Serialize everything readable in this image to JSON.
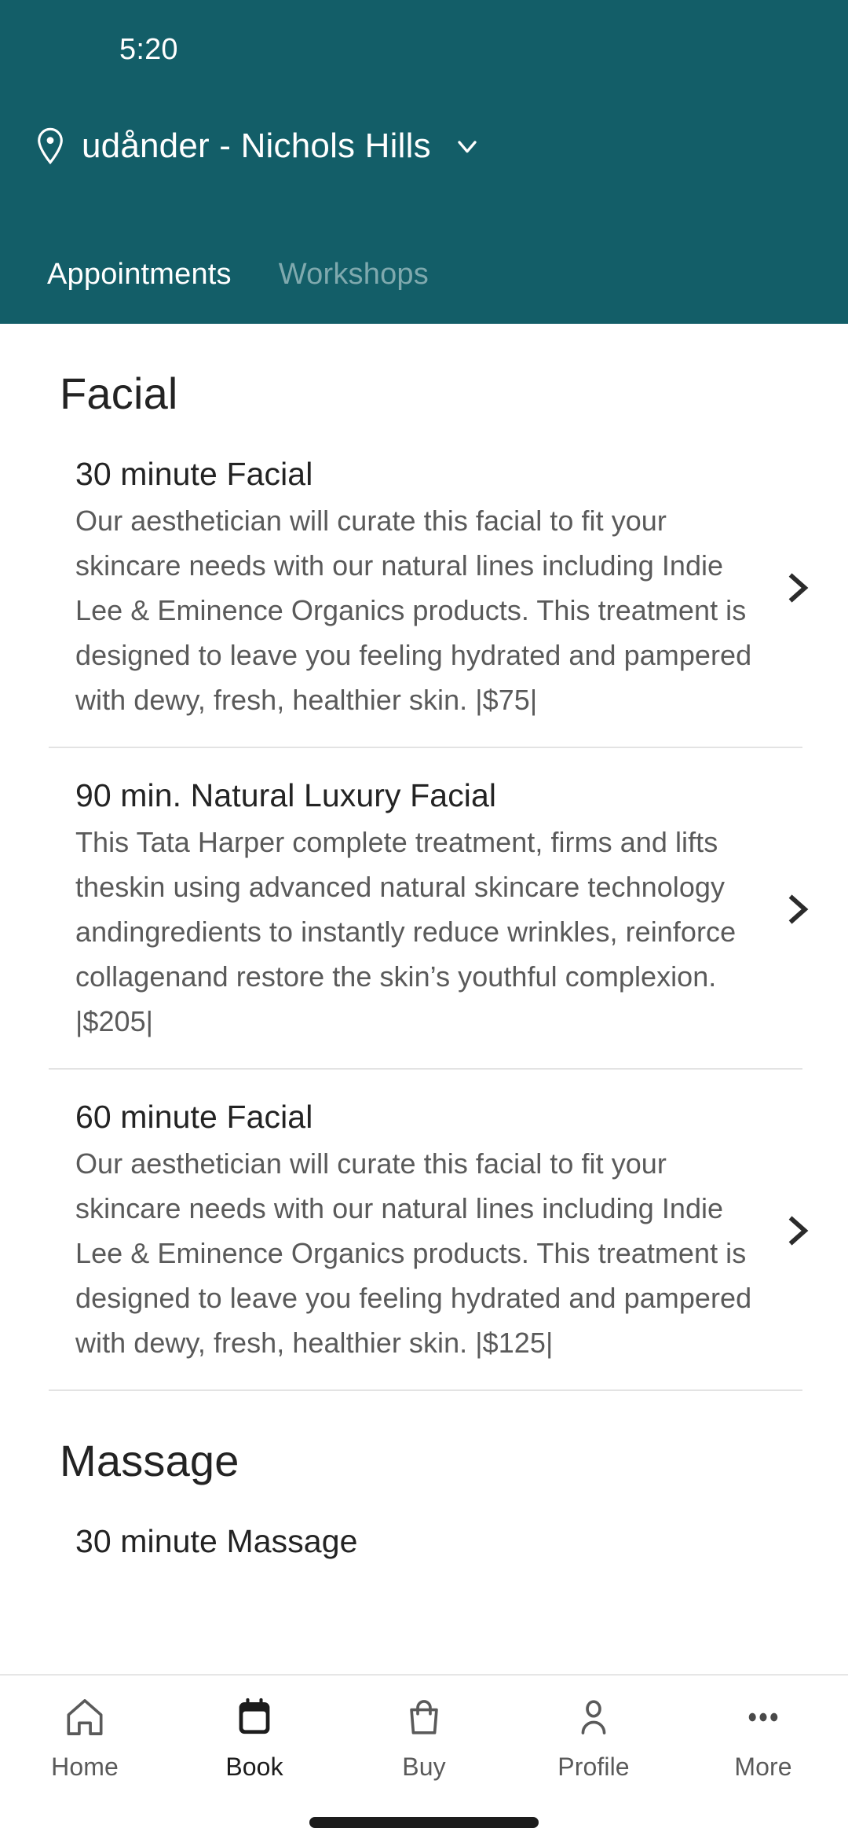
{
  "status_bar": {
    "time": "5:20"
  },
  "header": {
    "location_name": "udånder - Nichols Hills",
    "pin_icon": "location-pin-icon",
    "chevron_icon": "chevron-down-icon",
    "background_color": "#135e68",
    "tabs": [
      {
        "label": "Appointments",
        "active": true
      },
      {
        "label": "Workshops",
        "active": false
      }
    ]
  },
  "sections": [
    {
      "title": "Facial",
      "items": [
        {
          "title": "30 minute Facial",
          "description": "Our aesthetician will curate this facial to fit your skincare needs with our natural lines including Indie Lee & Eminence Organics products. This treatment is designed to leave you feeling hydrated and pampered with dewy, fresh, healthier skin.   |$75|",
          "price": "|$75|"
        },
        {
          "title": "90 min. Natural Luxury Facial",
          "description": "This Tata Harper complete treatment, firms and lifts theskin using advanced natural skincare technology andingredients to instantly reduce wrinkles, reinforce collagenand restore the skin’s youthful complexion. |$205|",
          "price": "|$205|"
        },
        {
          "title": "60 minute Facial",
          "description": "Our aesthetician will curate this facial to fit your skincare needs with our natural lines including Indie Lee & Eminence Organics products. This treatment is designed to leave you feeling hydrated and pampered with dewy, fresh, healthier skin.   |$125|",
          "price": "|$125|"
        }
      ]
    },
    {
      "title": "Massage",
      "items": [
        {
          "title": "30 minute Massage",
          "description": "",
          "price": ""
        }
      ]
    }
  ],
  "bottom_nav": [
    {
      "label": "Home",
      "icon": "home-icon",
      "active": false
    },
    {
      "label": "Book",
      "icon": "calendar-icon",
      "active": true
    },
    {
      "label": "Buy",
      "icon": "bag-icon",
      "active": false
    },
    {
      "label": "Profile",
      "icon": "person-icon",
      "active": false
    },
    {
      "label": "More",
      "icon": "ellipsis-icon",
      "active": false
    }
  ]
}
